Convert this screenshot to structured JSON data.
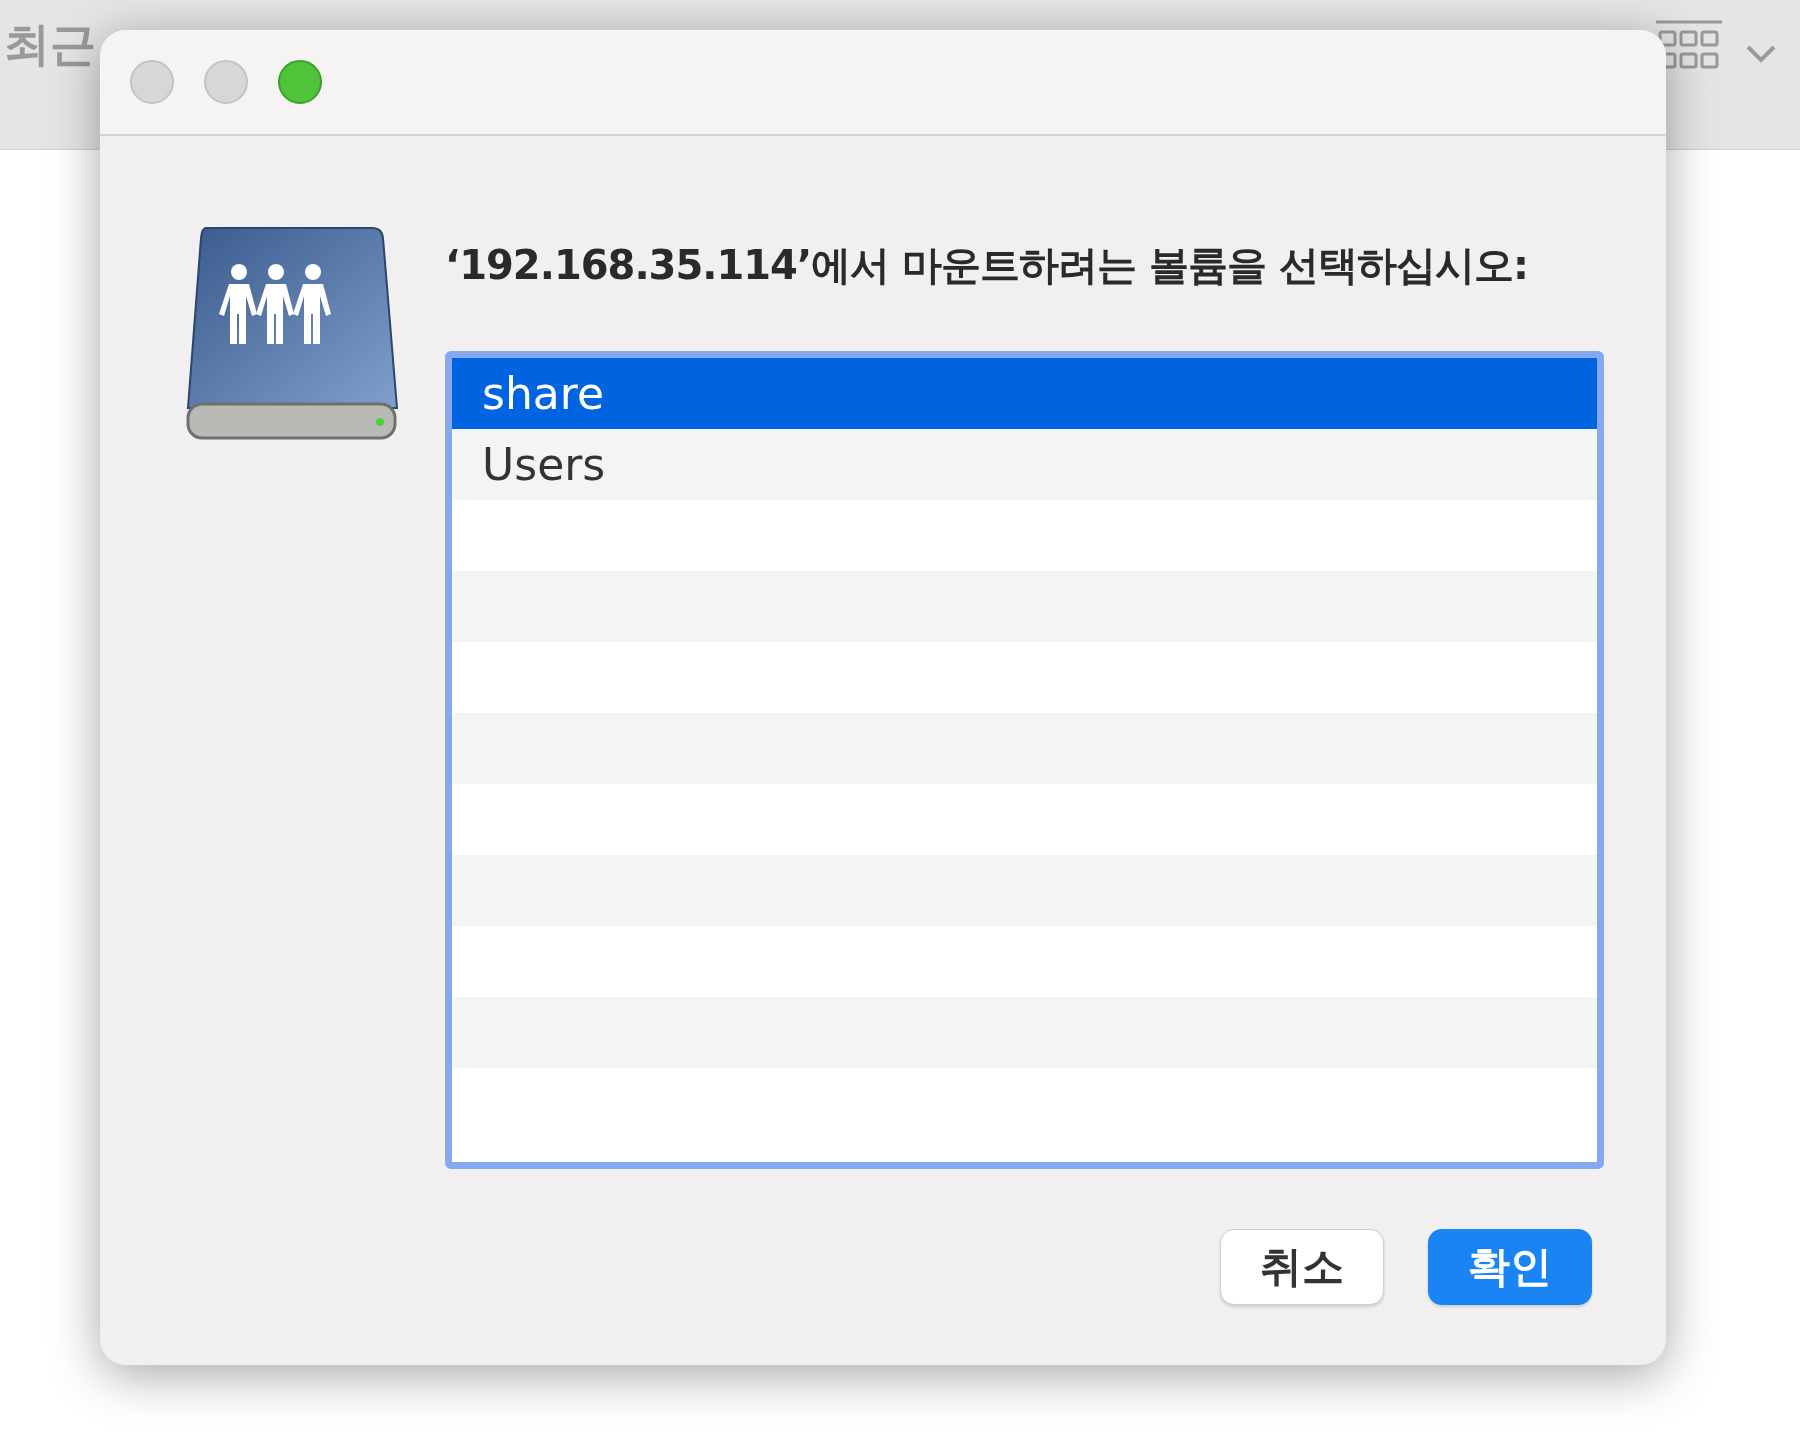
{
  "background_window": {
    "toolbar_title": "최근"
  },
  "dialog": {
    "traffic_lights": [
      {
        "kind": "close",
        "disabled": true
      },
      {
        "kind": "minimize",
        "disabled": true
      },
      {
        "kind": "zoom",
        "disabled": false
      }
    ],
    "prompt": "‘192.168.35.114’에서 마운트하려는 볼륨을 선택하십시오:",
    "volumes": [
      {
        "label": "share",
        "selected": true
      },
      {
        "label": "Users",
        "selected": false
      }
    ],
    "buttons": [
      {
        "label": "취소",
        "kind": "cancel"
      },
      {
        "label": "확인",
        "kind": "default"
      }
    ]
  }
}
